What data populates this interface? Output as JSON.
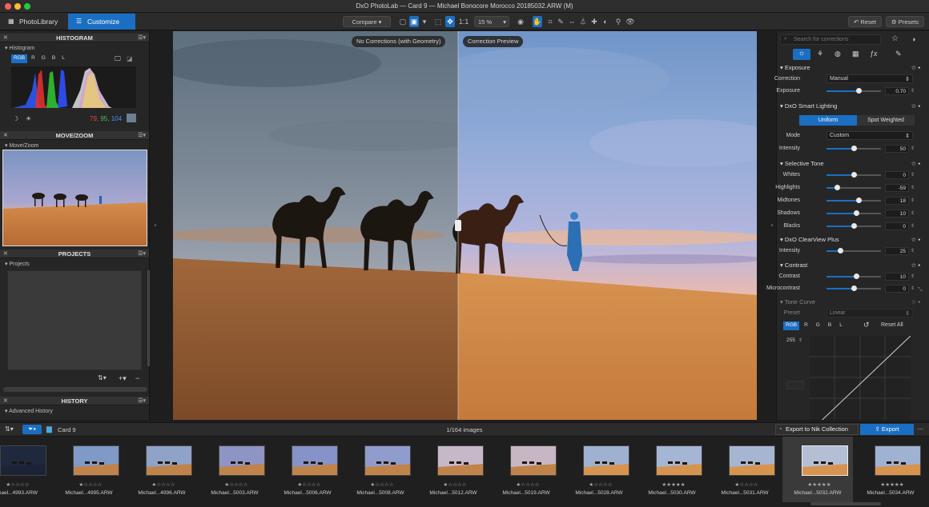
{
  "window": {
    "title": "DxO PhotoLab — Card 9 — Michael Bonocore Morocco 20185032.ARW (M)"
  },
  "tabs": {
    "photolibrary": "PhotoLibrary",
    "customize": "Customize"
  },
  "toolbar": {
    "compare": "Compare",
    "ratio": "1:1",
    "zoom": "15 %",
    "reset": "Reset",
    "presets": "Presets"
  },
  "histogram": {
    "title": "HISTOGRAM",
    "sub": "Histogram",
    "channels": [
      "RGB",
      "R",
      "G",
      "B",
      "L"
    ],
    "r": "79,",
    "g": "95,",
    "b": "104"
  },
  "movezoom": {
    "title": "MOVE/ZOOM",
    "sub": "Move/Zoom"
  },
  "projects": {
    "title": "PROJECTS",
    "sub": "Projects"
  },
  "history": {
    "title": "HISTORY",
    "sub": "Advanced History"
  },
  "viewer": {
    "left_label": "No Corrections (with Geometry)",
    "right_label": "Correction Preview"
  },
  "right": {
    "search_placeholder": "Search for corrections",
    "exposure": {
      "title": "Exposure",
      "correction_label": "Correction",
      "correction_value": "Manual",
      "exposure_label": "Exposure",
      "exposure_value": "0.70",
      "exposure_level": 0.6
    },
    "smart": {
      "title": "DxO Smart Lighting",
      "uniform": "Uniform",
      "spot": "Spot Weighted",
      "mode_label": "Mode",
      "mode_value": "Custom",
      "intensity_label": "Intensity",
      "intensity_value": "50",
      "intensity_level": 0.5
    },
    "tone": {
      "title": "Selective Tone",
      "rows": [
        {
          "label": "Whites",
          "value": "0",
          "level": 0.5
        },
        {
          "label": "Highlights",
          "value": "-59",
          "level": 0.2
        },
        {
          "label": "Midtones",
          "value": "18",
          "level": 0.59
        },
        {
          "label": "Shadows",
          "value": "10",
          "level": 0.55
        },
        {
          "label": "Blacks",
          "value": "0",
          "level": 0.5
        }
      ]
    },
    "clearview": {
      "title": "DxO ClearView Plus",
      "intensity_label": "Intensity",
      "intensity_value": "25",
      "level": 0.25
    },
    "contrast": {
      "title": "Contrast",
      "contrast_label": "Contrast",
      "contrast_value": "10",
      "contrast_level": 0.55,
      "micro_label": "Microcontrast",
      "micro_value": "0",
      "micro_level": 0.5
    },
    "curve": {
      "title": "Tone Curve",
      "preset_label": "Preset",
      "preset_value": "Linear",
      "channels": [
        "RGB",
        "R",
        "G",
        "B",
        "L"
      ],
      "reset_all": "Reset All",
      "value_255": "255"
    }
  },
  "filmbar": {
    "folder": "Card 9",
    "count": "1/164 images",
    "nik": "Export to Nik Collection",
    "export": "Export"
  },
  "thumbs": [
    {
      "name": "ichael...4993.ARW",
      "stars": "★☆☆☆☆"
    },
    {
      "name": "Michael...4995.ARW",
      "stars": "★☆☆☆☆"
    },
    {
      "name": "Michael...4996.ARW",
      "stars": "★☆☆☆☆"
    },
    {
      "name": "Michael...5003.ARW",
      "stars": "★☆☆☆☆"
    },
    {
      "name": "Michael...5006.ARW",
      "stars": "★☆☆☆☆"
    },
    {
      "name": "Michael...5008.ARW",
      "stars": "★☆☆☆☆"
    },
    {
      "name": "Michael...5012.ARW",
      "stars": "★☆☆☆☆"
    },
    {
      "name": "Michael...5019.ARW",
      "stars": "★☆☆☆☆"
    },
    {
      "name": "Michael...5028.ARW",
      "stars": "★☆☆☆☆"
    },
    {
      "name": "Michael...5030.ARW",
      "stars": "★★★★★"
    },
    {
      "name": "Michael...5031.ARW",
      "stars": "★☆☆☆☆"
    },
    {
      "name": "Michael...5032.ARW",
      "stars": "★★★★★"
    },
    {
      "name": "Michael...5034.ARW",
      "stars": "★★★★★"
    }
  ],
  "colors": {
    "accent": "#1b6fc2",
    "red": "#e0463a",
    "green": "#4cc04c",
    "blue": "#4c8cff"
  }
}
